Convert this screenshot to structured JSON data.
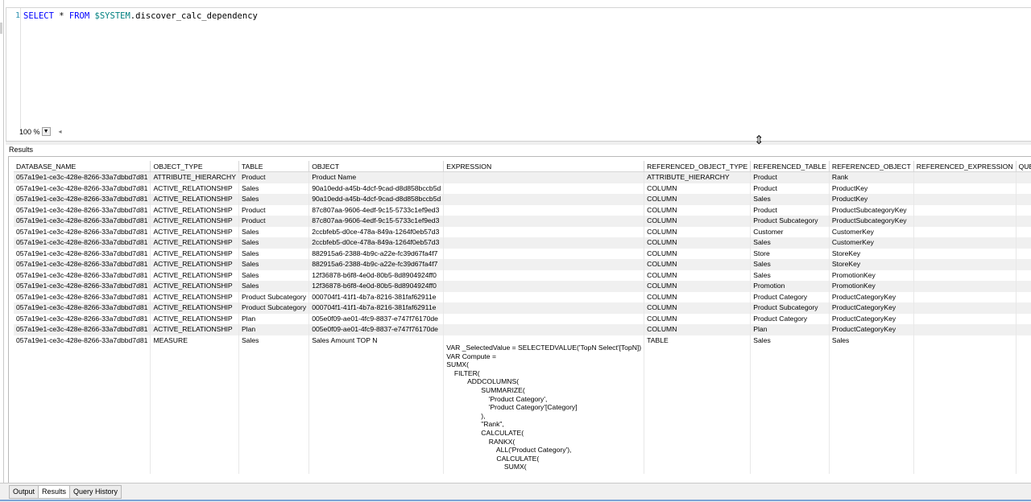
{
  "editor": {
    "line_number": "1",
    "code": {
      "select": "SELECT",
      "star": " * ",
      "from": "FROM",
      "space": " ",
      "object": "$SYSTEM",
      "rest": ".discover_calc_dependency"
    },
    "zoom_value": "100 %"
  },
  "results_label": "Results",
  "grid": {
    "columns": [
      "DATABASE_NAME",
      "OBJECT_TYPE",
      "TABLE",
      "OBJECT",
      "EXPRESSION",
      "REFERENCED_OBJECT_TYPE",
      "REFERENCED_TABLE",
      "REFERENCED_OBJECT",
      "REFERENCED_EXPRESSION",
      "QUERY"
    ],
    "rows": [
      [
        "057a19e1-ce3c-428e-8266-33a7dbbd7d81",
        "ATTRIBUTE_HIERARCHY",
        "Product",
        "Product Name",
        "",
        "ATTRIBUTE_HIERARCHY",
        "Product",
        "Rank",
        "",
        ""
      ],
      [
        "057a19e1-ce3c-428e-8266-33a7dbbd7d81",
        "ACTIVE_RELATIONSHIP",
        "Sales",
        "90a10edd-a45b-4dcf-9cad-d8d858bccb5d",
        "",
        "COLUMN",
        "Product",
        "ProductKey",
        "",
        ""
      ],
      [
        "057a19e1-ce3c-428e-8266-33a7dbbd7d81",
        "ACTIVE_RELATIONSHIP",
        "Sales",
        "90a10edd-a45b-4dcf-9cad-d8d858bccb5d",
        "",
        "COLUMN",
        "Sales",
        "ProductKey",
        "",
        ""
      ],
      [
        "057a19e1-ce3c-428e-8266-33a7dbbd7d81",
        "ACTIVE_RELATIONSHIP",
        "Product",
        "87c807aa-9606-4edf-9c15-5733c1ef9ed3",
        "",
        "COLUMN",
        "Product",
        "ProductSubcategoryKey",
        "",
        ""
      ],
      [
        "057a19e1-ce3c-428e-8266-33a7dbbd7d81",
        "ACTIVE_RELATIONSHIP",
        "Product",
        "87c807aa-9606-4edf-9c15-5733c1ef9ed3",
        "",
        "COLUMN",
        "Product Subcategory",
        "ProductSubcategoryKey",
        "",
        ""
      ],
      [
        "057a19e1-ce3c-428e-8266-33a7dbbd7d81",
        "ACTIVE_RELATIONSHIP",
        "Sales",
        "2ccbfeb5-d0ce-478a-849a-1264f0eb57d3",
        "",
        "COLUMN",
        "Customer",
        "CustomerKey",
        "",
        ""
      ],
      [
        "057a19e1-ce3c-428e-8266-33a7dbbd7d81",
        "ACTIVE_RELATIONSHIP",
        "Sales",
        "2ccbfeb5-d0ce-478a-849a-1264f0eb57d3",
        "",
        "COLUMN",
        "Sales",
        "CustomerKey",
        "",
        ""
      ],
      [
        "057a19e1-ce3c-428e-8266-33a7dbbd7d81",
        "ACTIVE_RELATIONSHIP",
        "Sales",
        "882915a6-2388-4b9c-a22e-fc39d67fa4f7",
        "",
        "COLUMN",
        "Store",
        "StoreKey",
        "",
        ""
      ],
      [
        "057a19e1-ce3c-428e-8266-33a7dbbd7d81",
        "ACTIVE_RELATIONSHIP",
        "Sales",
        "882915a6-2388-4b9c-a22e-fc39d67fa4f7",
        "",
        "COLUMN",
        "Sales",
        "StoreKey",
        "",
        ""
      ],
      [
        "057a19e1-ce3c-428e-8266-33a7dbbd7d81",
        "ACTIVE_RELATIONSHIP",
        "Sales",
        "12f36878-b6f8-4e0d-80b5-8d8904924ff0",
        "",
        "COLUMN",
        "Sales",
        "PromotionKey",
        "",
        ""
      ],
      [
        "057a19e1-ce3c-428e-8266-33a7dbbd7d81",
        "ACTIVE_RELATIONSHIP",
        "Sales",
        "12f36878-b6f8-4e0d-80b5-8d8904924ff0",
        "",
        "COLUMN",
        "Promotion",
        "PromotionKey",
        "",
        ""
      ],
      [
        "057a19e1-ce3c-428e-8266-33a7dbbd7d81",
        "ACTIVE_RELATIONSHIP",
        "Product Subcategory",
        "000704f1-41f1-4b7a-8216-381faf62911e",
        "",
        "COLUMN",
        "Product Category",
        "ProductCategoryKey",
        "",
        ""
      ],
      [
        "057a19e1-ce3c-428e-8266-33a7dbbd7d81",
        "ACTIVE_RELATIONSHIP",
        "Product Subcategory",
        "000704f1-41f1-4b7a-8216-381faf62911e",
        "",
        "COLUMN",
        "Product Subcategory",
        "ProductCategoryKey",
        "",
        ""
      ],
      [
        "057a19e1-ce3c-428e-8266-33a7dbbd7d81",
        "ACTIVE_RELATIONSHIP",
        "Plan",
        "005e0f09-ae01-4fc9-8837-e747f76170de",
        "",
        "COLUMN",
        "Product Category",
        "ProductCategoryKey",
        "",
        ""
      ],
      [
        "057a19e1-ce3c-428e-8266-33a7dbbd7d81",
        "ACTIVE_RELATIONSHIP",
        "Plan",
        "005e0f09-ae01-4fc9-8837-e747f76170de",
        "",
        "COLUMN",
        "Plan",
        "ProductCategoryKey",
        "",
        ""
      ],
      [
        "057a19e1-ce3c-428e-8266-33a7dbbd7d81",
        "MEASURE",
        "Sales",
        "Sales Amount TOP N",
        "\nVAR _SelectedValue = SELECTEDVALUE('TopN Select'[TopN])\nVAR Compute =\nSUMX(\n    FILTER(\n           ADDCOLUMNS(\n                  SUMMARIZE(\n                      'Product Category',\n                      'Product Category'[Category]\n                  ),\n                  \"Rank\",\n                  CALCULATE(\n                      RANKX(\n                          ALL('Product Category'),\n                          CALCULATE(\n                              SUMX(",
        "TABLE",
        "Sales",
        "Sales",
        "",
        ""
      ]
    ]
  },
  "tabs": [
    "Output",
    "Results",
    "Query History"
  ],
  "active_tab": "Results",
  "icons": {
    "resize_cursor": "resize-cursor-icon",
    "zoom_dropdown": "chevron-down-icon",
    "scroll_left": "scroll-left-icon"
  }
}
